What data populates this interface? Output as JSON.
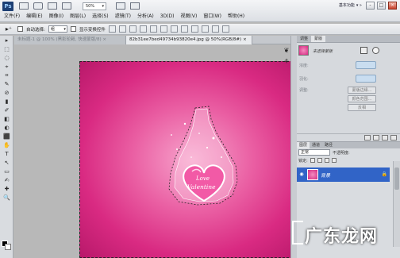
{
  "app": {
    "logo": "Ps",
    "zoom": "50%",
    "workspace": "基本功能",
    "menu": [
      "文件(F)",
      "编辑(E)",
      "图像(I)",
      "图层(L)",
      "选择(S)",
      "滤镜(T)",
      "分析(A)",
      "3D(D)",
      "视图(V)",
      "窗口(W)",
      "帮助(H)"
    ],
    "window_controls": [
      "-",
      "□",
      "×"
    ]
  },
  "options_bar": {
    "auto_select_label": "自动选择:",
    "auto_select_value": "组",
    "transform_label": "显示变换控件"
  },
  "tools": [
    "▸",
    "⬚",
    "◌",
    "⌖",
    "⌗",
    "✎",
    "⊘",
    "▮",
    "✐",
    "◧",
    "◐",
    "⬛",
    "✋",
    "T",
    "↖",
    "▭",
    "✍",
    "✚",
    "🔍"
  ],
  "tabs": [
    {
      "label": "未标题-1 @ 100% (黑影轮毂, 快速蒙版/8) ×",
      "active": false
    },
    {
      "label": "82b31ee7bed49734b93820e4.jpg @ 50%(RGB/8#)",
      "active": true
    }
  ],
  "panel": {
    "tabs": [
      "调整",
      "蒙版"
    ],
    "mask_name": "未选择蒙版",
    "rows": [
      "浓度:",
      "羽化:"
    ],
    "refine_label": "调整:",
    "buttons": [
      "蒙版边缘...",
      "颜色范围...",
      "反相"
    ]
  },
  "layers": {
    "tabs": [
      "图层",
      "通道",
      "路径"
    ],
    "blend_mode": "正常",
    "opacity_label": "不透明度:",
    "lock_label": "锁定:",
    "layer_name": "背景"
  },
  "artwork": {
    "heart_text_1": "Love",
    "heart_text_2": "Valentine"
  },
  "watermark": {
    "text": "广东龙网"
  },
  "colors": {
    "accent": "#3164c7",
    "canvas_pink": "#d92a82"
  }
}
